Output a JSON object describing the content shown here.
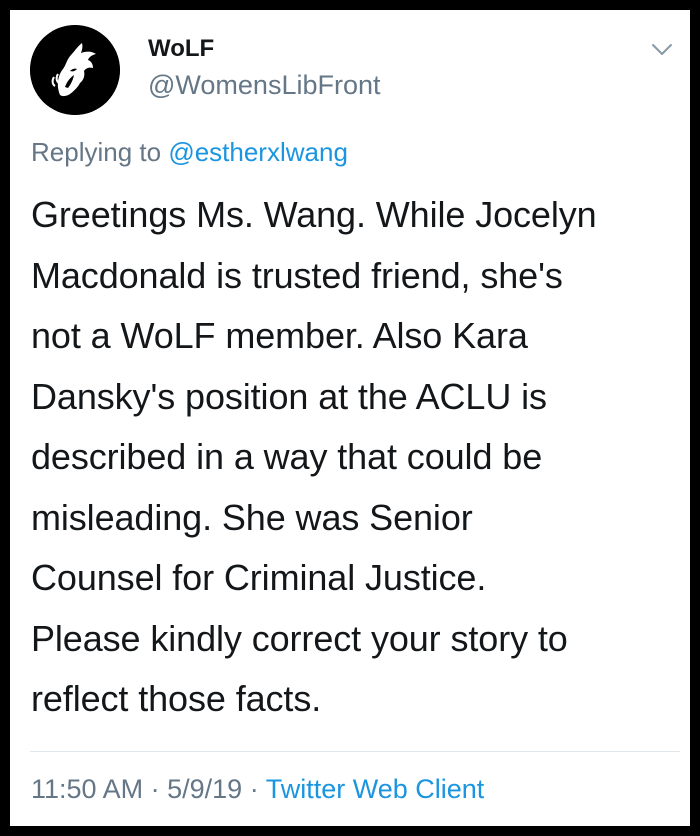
{
  "tweet": {
    "display_name": "WoLF",
    "handle": "@WomensLibFront",
    "reply_prefix": "Replying to",
    "reply_to": "@estherxlwang",
    "text_lines": [
      "Greetings Ms. Wang. While Jocelyn",
      "Macdonald is trusted friend, she's",
      "not a WoLF member. Also Kara",
      "Dansky's position at the ACLU is",
      "described in a way that could be",
      "misleading. She was Senior",
      "Counsel for Criminal Justice.",
      "Please kindly correct your story to",
      "reflect those facts."
    ],
    "time": "11:50 AM",
    "separator": "·",
    "date": "5/9/19",
    "client": "Twitter Web Client"
  },
  "icons": {
    "avatar": "wolf-logo",
    "menu": "chevron-down-icon"
  },
  "colors": {
    "text": "#14171a",
    "secondary": "#657786",
    "link": "#1b95e0",
    "frame": "#000000"
  }
}
